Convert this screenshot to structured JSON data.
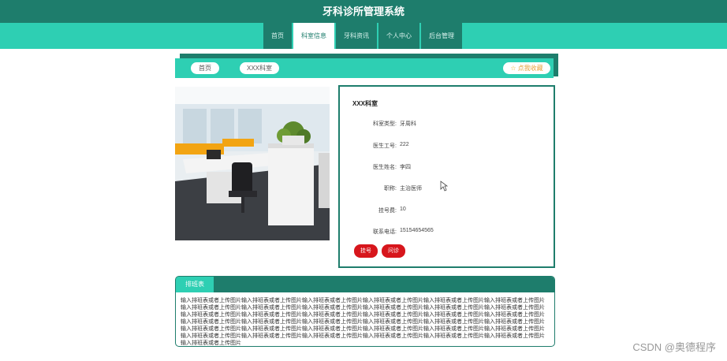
{
  "app_title": "牙科诊所管理系统",
  "nav": {
    "items": [
      {
        "label": "首页",
        "active": false
      },
      {
        "label": "科室信息",
        "active": true
      },
      {
        "label": "牙科资讯",
        "active": false
      },
      {
        "label": "个人中心",
        "active": false
      },
      {
        "label": "后台管理",
        "active": false
      }
    ]
  },
  "breadcrumb": {
    "home": "首页",
    "current": "XXX科室",
    "favorite": "点我收藏"
  },
  "photo": {
    "icon": "office-photo"
  },
  "detail": {
    "title": "XXX科室",
    "fields": [
      {
        "label": "科室类型:",
        "value": "牙周科"
      },
      {
        "label": "医生工号:",
        "value": "222"
      },
      {
        "label": "医生姓名:",
        "value": "李四"
      },
      {
        "label": "职称:",
        "value": "主治医师"
      },
      {
        "label": "挂号费:",
        "value": "10"
      },
      {
        "label": "联系电话:",
        "value": "15154654565"
      }
    ],
    "register_button": "挂号",
    "diagnosis_button": "问诊"
  },
  "schedule": {
    "tab_label": "排班表",
    "text": "输入排班表或者上传图片输入排班表或者上传图片输入排班表或者上传图片输入排班表或者上传图片输入排班表或者上传图片输入排班表或者上传图片输入排班表或者上传图片输入排班表或者上传图片输入排班表或者上传图片输入排班表或者上传图片输入排班表或者上传图片输入排班表或者上传图片输入排班表或者上传图片输入排班表或者上传图片输入排班表或者上传图片输入排班表或者上传图片输入排班表或者上传图片输入排班表或者上传图片输入排班表或者上传图片输入排班表或者上传图片输入排班表或者上传图片输入排班表或者上传图片输入排班表或者上传图片输入排班表或者上传图片输入排班表或者上传图片输入排班表或者上传图片输入排班表或者上传图片输入排班表或者上传图片输入排班表或者上传图片输入排班表或者上传图片输入排班表或者上传图片输入排班表或者上传图片输入排班表或者上传图片输入排班表或者上传图片输入排班表或者上传图片输入排班表或者上传图片输入排班表或者上传图片"
  },
  "watermark": "CSDN @奥德程序"
}
